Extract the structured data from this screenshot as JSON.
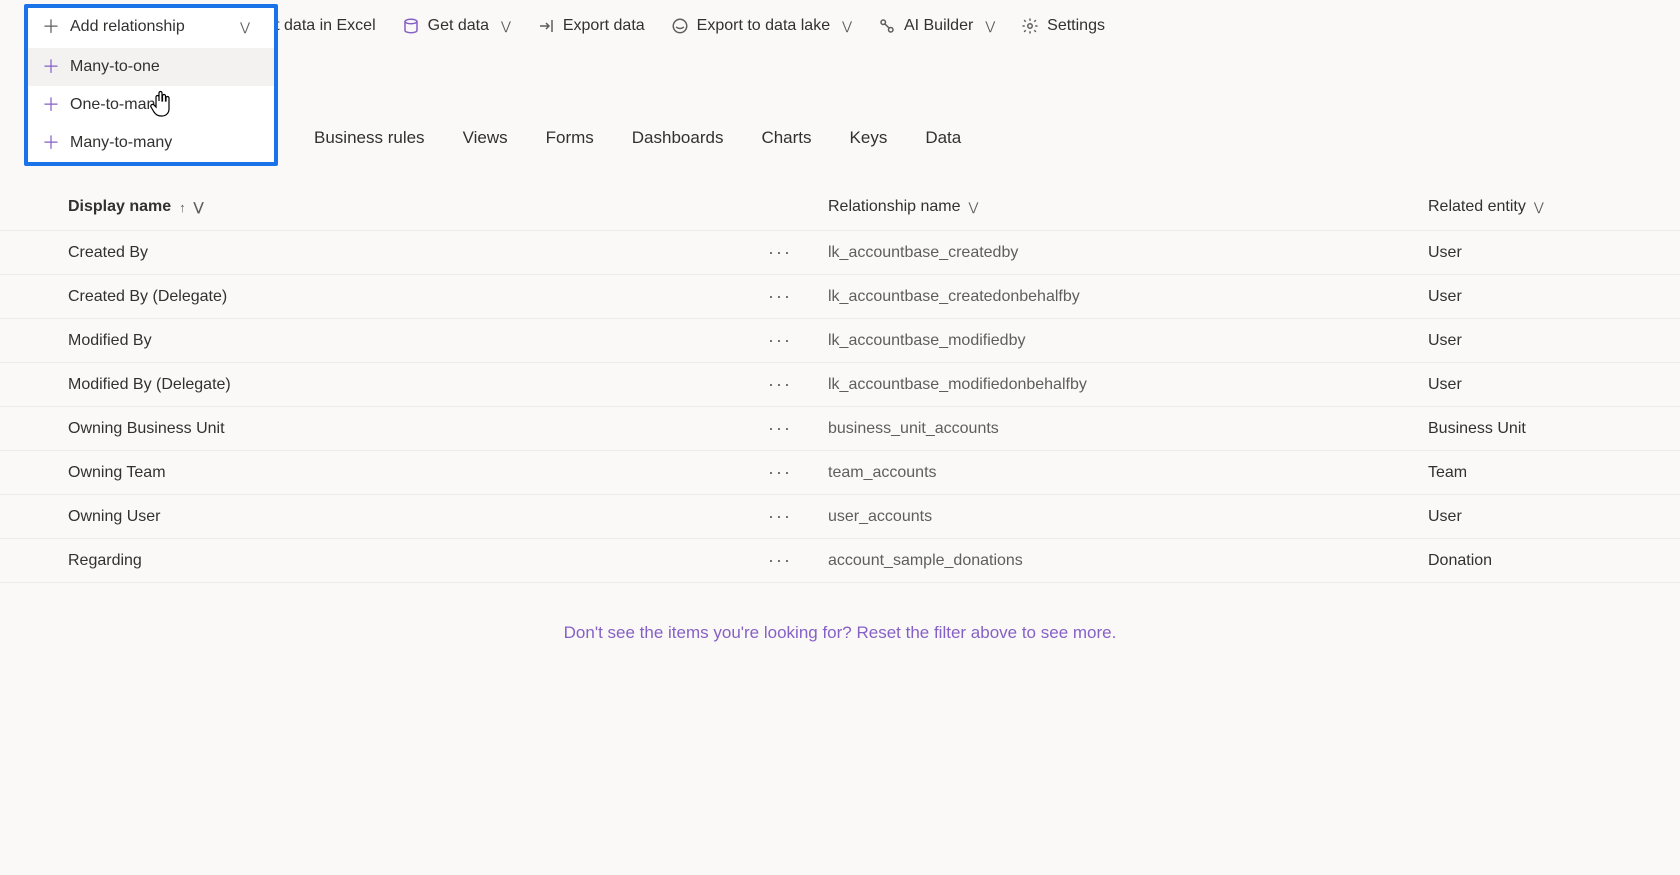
{
  "toolbar": {
    "add_relationship": "Add relationship",
    "edit_excel": "Edit data in Excel",
    "get_data": "Get data",
    "export_data": "Export data",
    "export_lake": "Export to data lake",
    "ai_builder": "AI Builder",
    "settings": "Settings"
  },
  "dropdown": {
    "header": "Add relationship",
    "items": [
      "Many-to-one",
      "One-to-many",
      "Many-to-many"
    ]
  },
  "tabs": [
    "Business rules",
    "Views",
    "Forms",
    "Dashboards",
    "Charts",
    "Keys",
    "Data"
  ],
  "columns": {
    "display_name": "Display name",
    "relationship_name": "Relationship name",
    "related_entity": "Related entity"
  },
  "rows": [
    {
      "display": "Created By",
      "rel": "lk_accountbase_createdby",
      "related": "User"
    },
    {
      "display": "Created By (Delegate)",
      "rel": "lk_accountbase_createdonbehalfby",
      "related": "User"
    },
    {
      "display": "Modified By",
      "rel": "lk_accountbase_modifiedby",
      "related": "User"
    },
    {
      "display": "Modified By (Delegate)",
      "rel": "lk_accountbase_modifiedonbehalfby",
      "related": "User"
    },
    {
      "display": "Owning Business Unit",
      "rel": "business_unit_accounts",
      "related": "Business Unit"
    },
    {
      "display": "Owning Team",
      "rel": "team_accounts",
      "related": "Team"
    },
    {
      "display": "Owning User",
      "rel": "user_accounts",
      "related": "User"
    },
    {
      "display": "Regarding",
      "rel": "account_sample_donations",
      "related": "Donation"
    }
  ],
  "footer_msg": "Don't see the items you're looking for? Reset the filter above to see more."
}
